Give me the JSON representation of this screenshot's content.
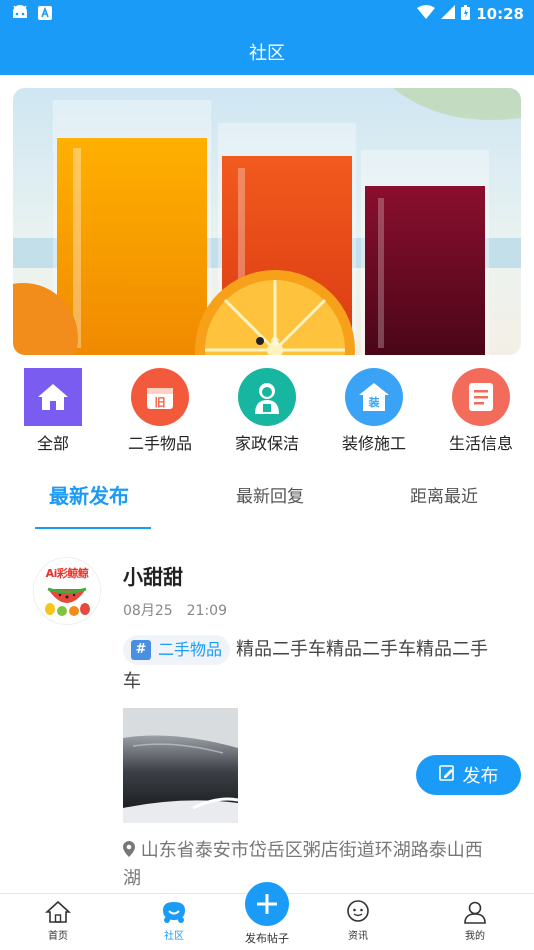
{
  "status_bar": {
    "time": "10:28"
  },
  "header": {
    "title": "社区"
  },
  "banner": {
    "slide_count": 2,
    "active_slide": 1
  },
  "categories": [
    {
      "label": "全部",
      "icon": "home-icon",
      "color": "#7b5cf0"
    },
    {
      "label": "二手物品",
      "icon": "secondhand-icon",
      "color": "#f35a3c"
    },
    {
      "label": "家政保洁",
      "icon": "cleaner-icon",
      "color": "#17b6a0"
    },
    {
      "label": "装修施工",
      "icon": "renovation-icon",
      "color": "#3aa3f5"
    },
    {
      "label": "生活信息",
      "icon": "life-info-icon",
      "color": "#f26b5b"
    }
  ],
  "tabs": [
    {
      "label": "最新发布",
      "active": true
    },
    {
      "label": "最新回复",
      "active": false
    },
    {
      "label": "距离最近",
      "active": false
    }
  ],
  "post": {
    "avatar_text": "Ai彩鲸鲸",
    "username": "小甜甜",
    "time": "08月25　21:09",
    "tag_hash": "#",
    "tag": "二手物品",
    "content": "精品二手车精品二手车精品二手车",
    "location": "山东省泰安市岱岳区粥店街道环湖路泰山西湖"
  },
  "publish_button": {
    "label": "发布"
  },
  "bottom_nav": {
    "home": "首页",
    "community": "社区",
    "post": "发布帖子",
    "news": "资讯",
    "mine": "我的"
  },
  "colors": {
    "primary": "#1a9bf7"
  }
}
